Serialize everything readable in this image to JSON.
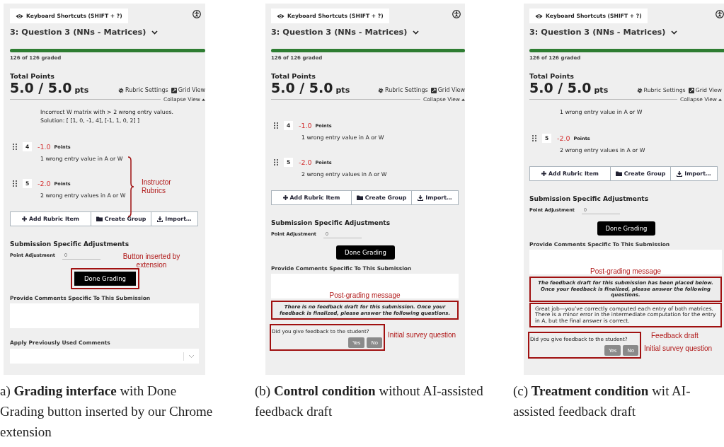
{
  "panels": [
    {
      "shortcuts": "Keyboard Shortcuts (SHIFT + ?)",
      "question": "3: Question 3 (NNs - Matrices)",
      "progress": {
        "level": 1,
        "label": "126 of 126 graded"
      },
      "total_label": "Total Points",
      "score": "5.0 / 5.0",
      "score_unit": "pts",
      "rubric_settings": "Rubric Settings",
      "grid_view": "Grid View",
      "collapse": "Collapse View",
      "rubric": [
        {
          "kind": "text",
          "lines": [
            "Incorrect W matrix with > 2 wrong entry values.",
            "Solution: [ [1, 0, -1, 4], [-1, 1, 0, 2] ]"
          ]
        },
        {
          "kind": "item",
          "number": "4",
          "points": "-1.0",
          "unit": "Points",
          "description": "1 wrong entry value in A or W"
        },
        {
          "kind": "item",
          "number": "5",
          "points": "-2.0",
          "unit": "Points",
          "description": "2 wrong entry values in A or W"
        }
      ],
      "rubric_buttons": [
        "Add Rubric Item",
        "Create Group",
        "Import…"
      ],
      "adjustments_title": "Submission Specific Adjustments",
      "point_adjustment": {
        "label": "Point Adjustment",
        "value": "0"
      },
      "done_button": {
        "label": "Done Grading",
        "highlighted": true
      },
      "comments_label": "Provide Comments Specific To This Submission",
      "sections": [
        {
          "kind": "previous_comments",
          "label": "Apply Previously Used Comments"
        }
      ],
      "annotations": [
        {
          "kind": "brace",
          "text": "Instructor Rubrics"
        },
        {
          "kind": "side",
          "text": "Button inserted by extension"
        }
      ],
      "caption": "a) **Grading interface** with Done Grading button inserted by our Chrome extension"
    },
    {
      "shortcuts": "Keyboard Shortcuts (SHIFT + ?)",
      "question": "3: Question 3 (NNs - Matrices)",
      "progress": {
        "level": 1,
        "label": "126 of 126 graded"
      },
      "total_label": "Total Points",
      "score": "5.0 / 5.0",
      "score_unit": "pts",
      "rubric_settings": "Rubric Settings",
      "grid_view": "Grid View",
      "collapse": "Collapse View",
      "rubric": [
        {
          "kind": "item",
          "number": "4",
          "points": "-1.0",
          "unit": "Points",
          "description": "1 wrong entry value in A or W"
        },
        {
          "kind": "item",
          "number": "5",
          "points": "-2.0",
          "unit": "Points",
          "description": "2 wrong entry values in A or W"
        }
      ],
      "rubric_buttons": [
        "Add Rubric Item",
        "Create Group",
        "Import…"
      ],
      "adjustments_title": "Submission Specific Adjustments",
      "point_adjustment": {
        "label": "Point Adjustment",
        "value": "0"
      },
      "done_button": {
        "label": "Done Grading",
        "highlighted": false
      },
      "comments_label": "Provide Comments Specific To This Submission",
      "sections": [
        {
          "kind": "message",
          "text": "There is no feedback draft for this submission. Once your feedback is finalized, please answer the following questions."
        },
        {
          "kind": "survey",
          "question": "Did you give feedback to the student?",
          "buttons": [
            "Yes",
            "No"
          ]
        }
      ],
      "annotations": [
        {
          "kind": "over",
          "text": "Post-grading message"
        },
        {
          "kind": "side",
          "text": "Initial survey question"
        }
      ],
      "caption": "(b) **Control condition** without AI-assisted feedback draft"
    },
    {
      "shortcuts": "Keyboard Shortcuts (SHIFT + ?)",
      "question": "3: Question 3 (NNs - Matrices)",
      "progress": {
        "level": 1,
        "label": "126 of 126 graded"
      },
      "total_label": "Total Points",
      "score": "5.0 / 5.0",
      "score_unit": "pts",
      "rubric_settings": "Rubric Settings",
      "grid_view": "Grid View",
      "collapse": "Collapse View",
      "rubric": [
        {
          "kind": "text",
          "lines": [
            "1 wrong entry value in A or W"
          ]
        },
        {
          "kind": "item",
          "number": "5",
          "points": "-2.0",
          "unit": "Points",
          "description": "2 wrong entry values in A or W"
        }
      ],
      "rubric_buttons": [
        "Add Rubric Item",
        "Create Group",
        "Import…"
      ],
      "adjustments_title": "Submission Specific Adjustments",
      "point_adjustment": {
        "label": "Point Adjustment",
        "value": "0"
      },
      "done_button": {
        "label": "Done Grading",
        "highlighted": false
      },
      "comments_label": "Provide Comments Specific To This Submission",
      "sections": [
        {
          "kind": "message",
          "text": "The feedback draft for this submission has been placed below. Once your feedback is finalized, please answer the following questions."
        },
        {
          "kind": "draft",
          "text": "Great job—you’ve correctly computed each entry of both matrices. There is a minor error in the intermediate computation for the entry in A, but the final answer is correct."
        },
        {
          "kind": "survey",
          "question": "Did you give feedback to the student?",
          "buttons": [
            "Yes",
            "No"
          ]
        }
      ],
      "annotations": [
        {
          "kind": "over",
          "text": "Post-grading message"
        },
        {
          "kind": "side",
          "text": "Feedback draft"
        },
        {
          "kind": "side",
          "text": "Initial survey question"
        }
      ],
      "caption": "(c) **Treatment condition** wit AI-assisted feedback draft"
    }
  ]
}
